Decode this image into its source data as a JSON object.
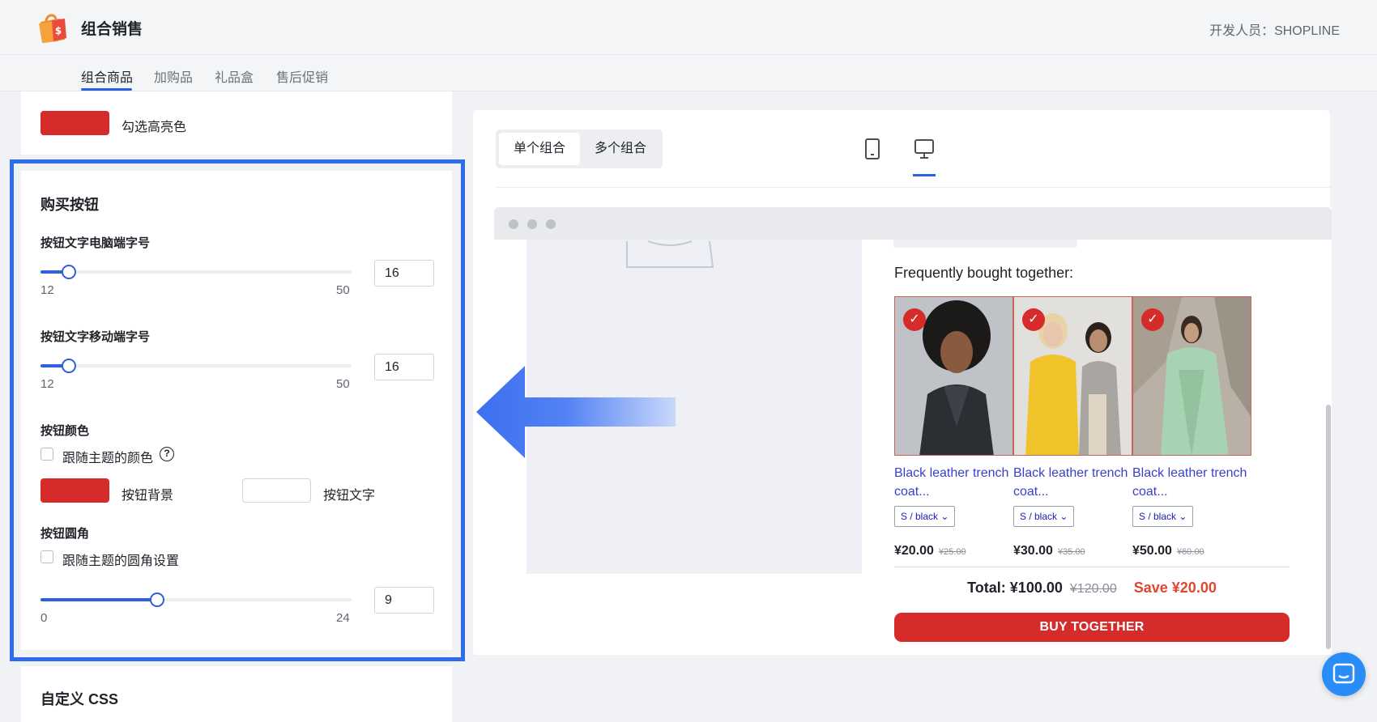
{
  "header": {
    "app_title": "组合销售",
    "developer": "开发人员：SHOPLINE"
  },
  "tabs": [
    {
      "label": "组合商品",
      "active": true
    },
    {
      "label": "加购品",
      "active": false
    },
    {
      "label": "礼品盒",
      "active": false
    },
    {
      "label": "售后促销",
      "active": false
    }
  ],
  "highlight_color": {
    "label": "勾选高亮色",
    "color": "#d52b2b"
  },
  "buy_button_section": {
    "title": "购买按钮",
    "desktop_font": {
      "label": "按钮文字电脑端字号",
      "min": "12",
      "max": "50",
      "value": "16",
      "fraction": 0.09
    },
    "mobile_font": {
      "label": "按钮文字移动端字号",
      "min": "12",
      "max": "50",
      "value": "16",
      "fraction": 0.09
    },
    "color": {
      "label": "按钮颜色",
      "follow_theme": "跟随主题的颜色",
      "follow_theme_checked": false,
      "help_icon": "?",
      "bg_label": "按钮背景",
      "bg_color": "#d52b2b",
      "text_label": "按钮文字",
      "text_color": "#ffffff"
    },
    "radius": {
      "label": "按钮圆角",
      "follow_theme": "跟随主题的圆角设置",
      "follow_theme_checked": false,
      "min": "0",
      "max": "24",
      "value": "9",
      "fraction": 0.375
    }
  },
  "custom_css": {
    "title": "自定义 CSS"
  },
  "preview": {
    "mode_single": "单个组合",
    "mode_multi": "多个组合",
    "active_mode": "单个组合",
    "device_icons": [
      "mobile-icon",
      "desktop-icon"
    ],
    "active_device": "desktop",
    "widget": {
      "title": "Frequently bought together:",
      "products": [
        {
          "name": "Black leather trench coat...",
          "variant": "S / black",
          "price": "¥20.00",
          "old_price": "¥25.00",
          "checked": true
        },
        {
          "name": "Black leather trench coat...",
          "variant": "S / black",
          "price": "¥30.00",
          "old_price": "¥35.00",
          "checked": true
        },
        {
          "name": "Black leather trench coat...",
          "variant": "S / black",
          "price": "¥50.00",
          "old_price": "¥60.00",
          "checked": true
        }
      ],
      "total_label": "Total: ¥100.00",
      "total_old": "¥120.00",
      "save_label": "Save ¥20.00",
      "buy_button": "BUY TOGETHER"
    }
  },
  "colors": {
    "accent_blue": "#2d5fe0",
    "highlight_frame": "#2f6bed",
    "brand_red": "#d52b2b",
    "save_orange": "#e0472c",
    "product_link": "#3a3fc9"
  }
}
